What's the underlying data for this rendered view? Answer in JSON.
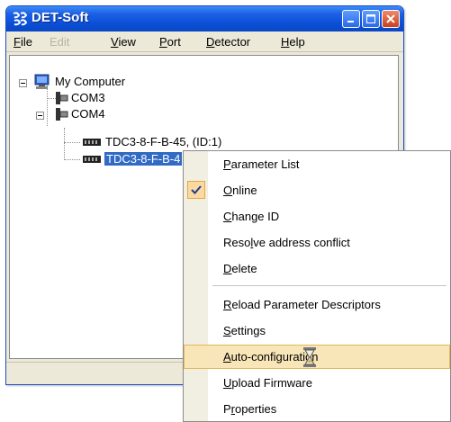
{
  "window": {
    "title": "DET-Soft"
  },
  "menubar": {
    "items": [
      {
        "label": "File",
        "accel": "F",
        "rest": "ile",
        "enabled": true
      },
      {
        "label": "Edit",
        "enabled": false
      },
      {
        "label": "View",
        "accel": "V",
        "rest": "iew",
        "enabled": true
      },
      {
        "label": "Port",
        "accel": "P",
        "rest": "ort",
        "enabled": true
      },
      {
        "label": "Detector",
        "accel": "D",
        "rest": "etector",
        "enabled": true
      },
      {
        "label": "Help",
        "accel": "H",
        "rest": "elp",
        "enabled": true
      }
    ]
  },
  "tree": {
    "root": "My Computer",
    "nodes": [
      "COM3",
      "COM4",
      "TDC3-8-F-B-45, (ID:1)",
      "TDC3-8-F-B-4"
    ]
  },
  "context_menu": {
    "items": [
      {
        "label": "Parameter List",
        "accel": "P",
        "rest": "arameter List"
      },
      {
        "label": "Online",
        "accel": "O",
        "rest": "nline",
        "checked": true
      },
      {
        "label": "Change ID",
        "accel": "C",
        "rest": "hange ID"
      },
      {
        "label": "Resolve address conflict",
        "pre": "Reso",
        "accel": "l",
        "rest": "ve address conflict"
      },
      {
        "label": "Delete",
        "accel": "D",
        "rest": "elete"
      },
      {
        "label": "Reload Parameter Descriptors",
        "accel": "R",
        "rest": "eload Parameter Descriptors"
      },
      {
        "label": "Settings",
        "accel": "S",
        "rest": "ettings"
      },
      {
        "label": "Auto-configuration",
        "accel": "A",
        "rest": "uto-configuration",
        "highlighted": true
      },
      {
        "label": "Upload Firmware",
        "accel": "U",
        "rest": "pload Firmware"
      },
      {
        "label": "Properties",
        "pre": "P",
        "accel": "r",
        "rest": "operties"
      }
    ]
  },
  "cursor": {
    "icon": "hourglass-icon"
  },
  "colors": {
    "titlebar": "#0a4fd6",
    "selection": "#316ac5",
    "menu_highlight": "#f8e6b8",
    "check_bg": "#fbd9a0"
  }
}
